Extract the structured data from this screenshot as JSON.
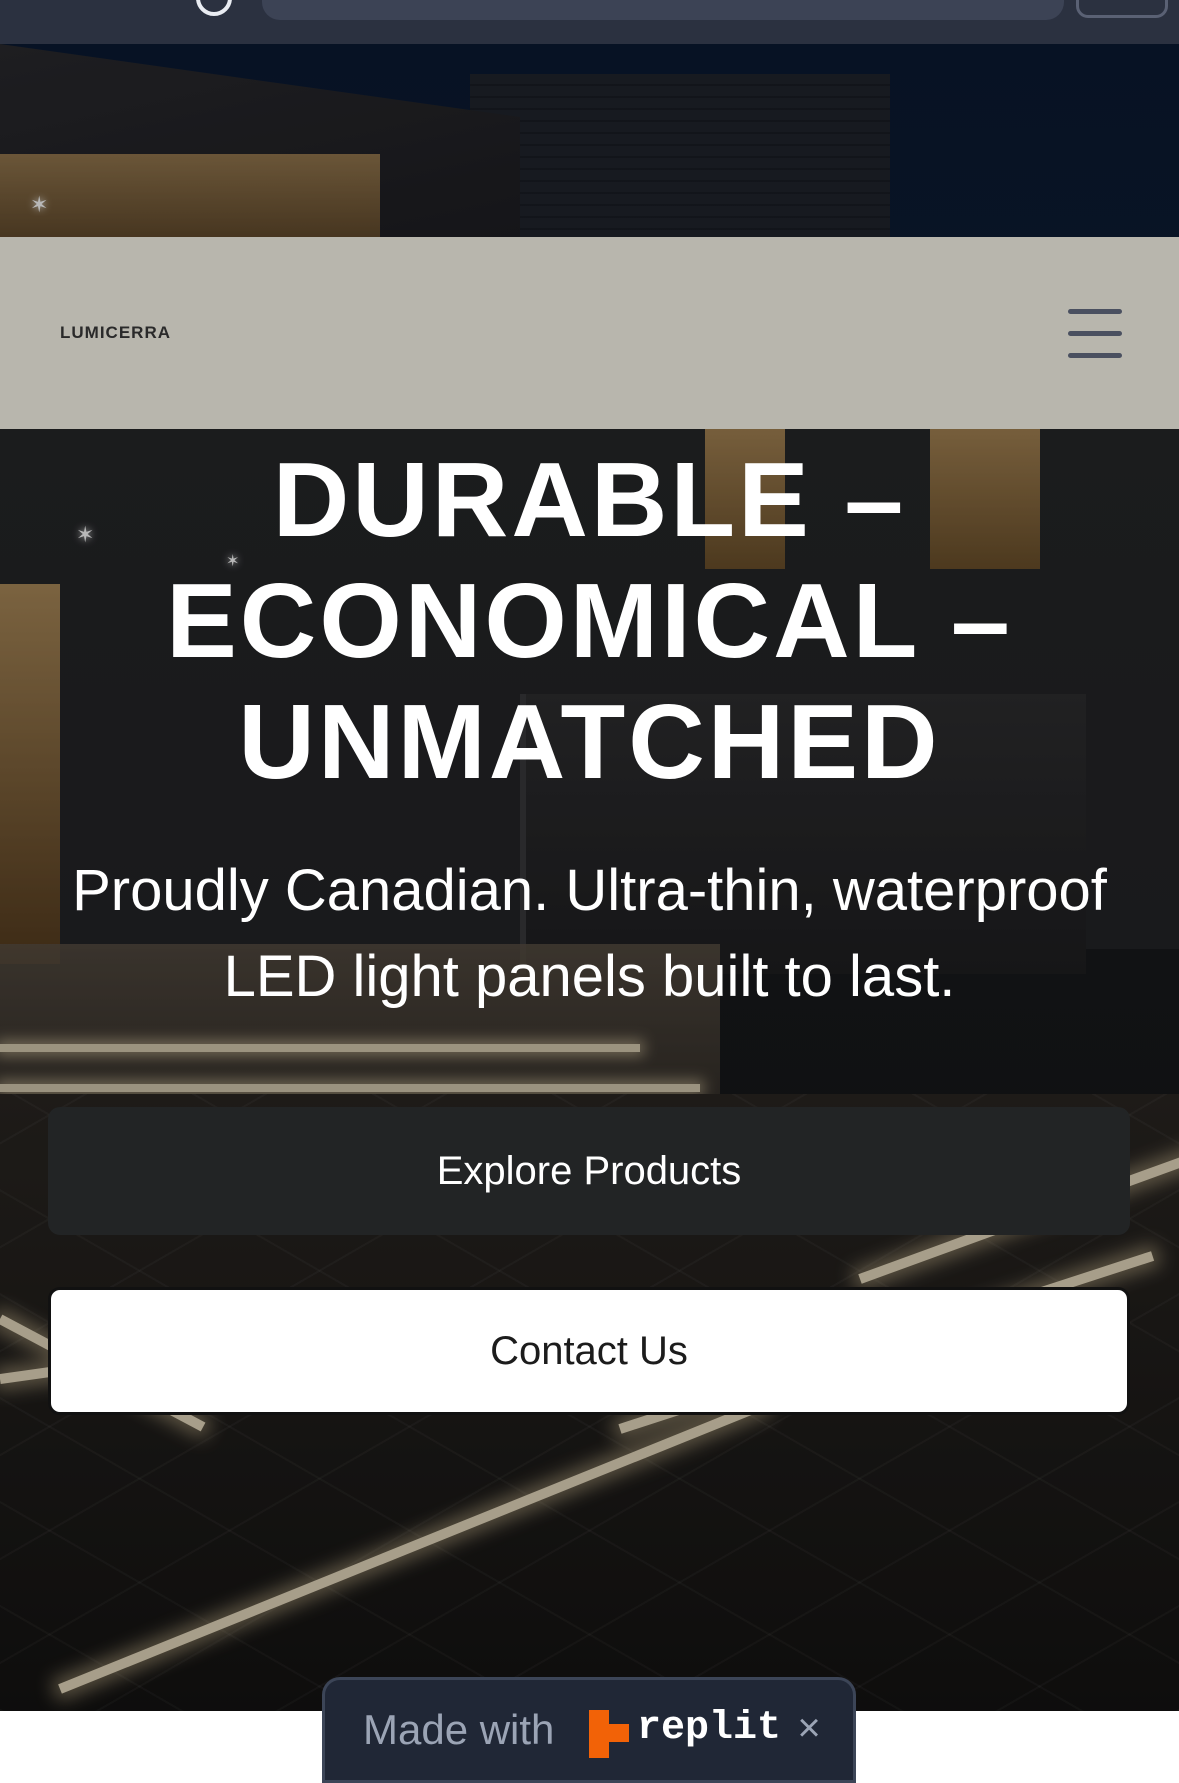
{
  "header": {
    "logo_text": "LUMICERRA",
    "menu_icon": "hamburger-menu-icon"
  },
  "hero": {
    "title": "DURABLE – ECONOMICAL – UNMATCHED",
    "subtitle": "Proudly Canadian. Ultra-thin, waterproof LED light panels built to last.",
    "buttons": {
      "explore_label": "Explore Products",
      "contact_label": "Contact Us"
    }
  },
  "badge": {
    "made_with": "Made with",
    "brand": "replit",
    "brand_color": "#f26207",
    "close_symbol": "×"
  },
  "colors": {
    "header_bg": "#b8b6ad",
    "primary_button": "#222425",
    "secondary_button": "#ffffff"
  }
}
